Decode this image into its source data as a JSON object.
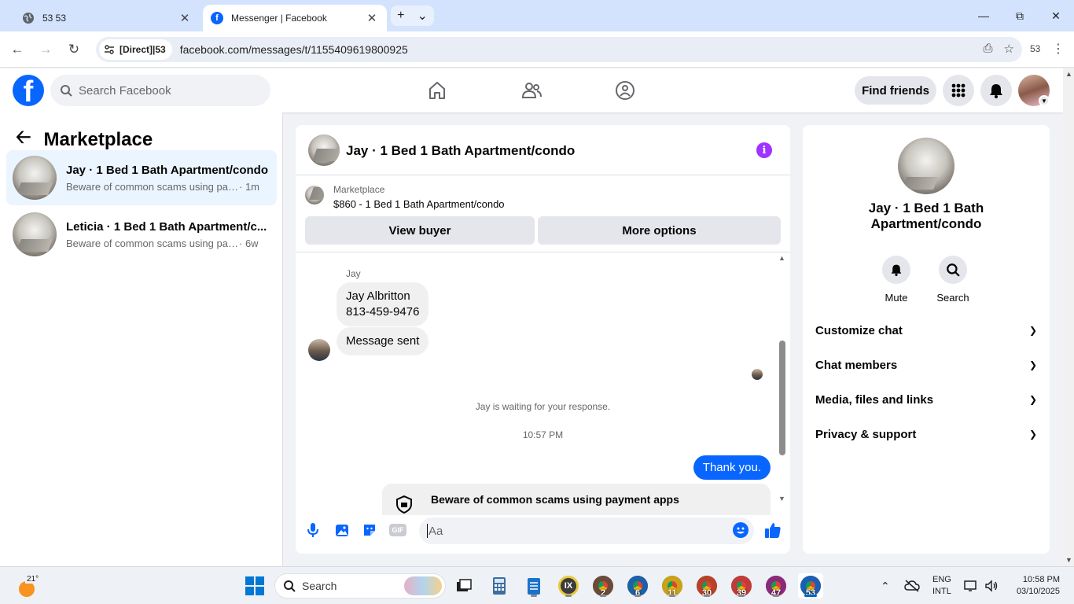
{
  "browser": {
    "tabs": [
      {
        "title": "53 53",
        "active": false
      },
      {
        "title": "Messenger | Facebook",
        "active": true
      }
    ],
    "new_tab_symbol": "+",
    "tab_search_symbol": "⌄",
    "close_symbol": "✕",
    "site_chip": "[Direct]|53",
    "url": "facebook.com/messages/t/1155409619800925",
    "profile_badge": "53"
  },
  "fb_header": {
    "logo_letter": "f",
    "search_placeholder": "Search Facebook",
    "find_friends_label": "Find friends"
  },
  "left_panel": {
    "title": "Marketplace",
    "conversations": [
      {
        "name": "Jay · 1 Bed 1 Bath Apartment/condo",
        "preview": "Beware of common scams using pay...",
        "time": "· 1m",
        "selected": true
      },
      {
        "name": "Leticia · 1 Bed 1 Bath Apartment/c...",
        "preview": "Beware of common scams using pay...",
        "time": "· 6w",
        "selected": false
      }
    ]
  },
  "chat": {
    "title": "Jay · 1 Bed 1 Bath Apartment/condo",
    "listing": {
      "label": "Marketplace",
      "price_title": "$860 - 1 Bed 1 Bath Apartment/condo",
      "view_buyer_label": "View buyer",
      "more_options_label": "More options"
    },
    "messages": {
      "sender": "Jay",
      "bubble1_line1": "Jay Albritton",
      "bubble1_line2": "813-459-9476",
      "bubble2": "Message sent",
      "waiting_text": "Jay is waiting for your response.",
      "timestamp": "10:57 PM",
      "outgoing": "Thank you.",
      "scam_warning": "Beware of common scams using payment apps"
    },
    "composer": {
      "placeholder": "Aa",
      "gif_label": "GIF"
    }
  },
  "info_panel": {
    "title_line1": "Jay · 1 Bed 1 Bath",
    "title_line2": "Apartment/condo",
    "actions": [
      {
        "label": "Mute",
        "icon": "bell-icon"
      },
      {
        "label": "Search",
        "icon": "search-icon"
      }
    ],
    "sections": [
      "Customize chat",
      "Chat members",
      "Media, files and links",
      "Privacy & support"
    ]
  },
  "taskbar": {
    "weather_temp": "21°",
    "search_label": "Search",
    "chrome_windows": [
      "2",
      "6",
      "11",
      "30",
      "39",
      "47",
      "53"
    ],
    "chrome_colors": [
      "#6b4a3a",
      "#1e5fa8",
      "#c9a21a",
      "#b8412a",
      "#c23a3a",
      "#8a2a7a",
      "#1a5fb4"
    ],
    "lang_line1": "ENG",
    "lang_line2": "INTL",
    "time": "10:58 PM",
    "date": "03/10/2025"
  },
  "colors": {
    "fb_blue": "#0866ff",
    "selected_conv_bg": "#ebf5ff",
    "info_purple": "#a033ff",
    "tabbar_bg": "#d3e3fd"
  }
}
